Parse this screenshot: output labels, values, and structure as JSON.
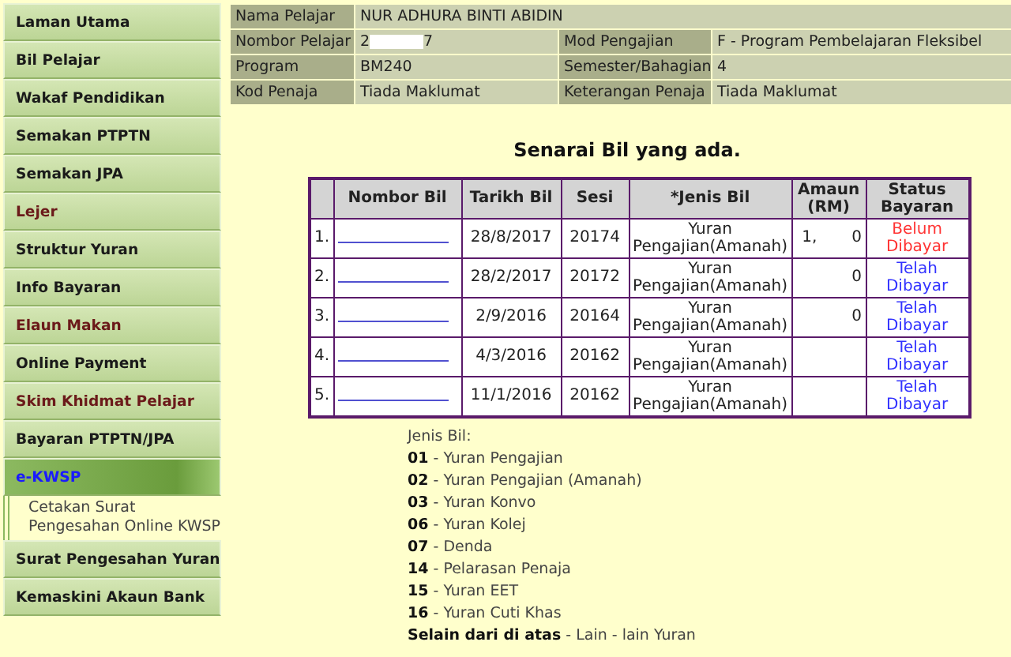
{
  "sidebar": {
    "items": [
      {
        "label": "Laman Utama",
        "color": "#1a1a1a",
        "selected": false
      },
      {
        "label": "Bil Pelajar",
        "color": "#1a1a1a",
        "selected": false
      },
      {
        "label": "Wakaf Pendidikan",
        "color": "#1a1a1a",
        "selected": false
      },
      {
        "label": "Semakan PTPTN",
        "color": "#1a1a1a",
        "selected": false
      },
      {
        "label": "Semakan JPA",
        "color": "#1a1a1a",
        "selected": false
      },
      {
        "label": "Lejer",
        "color": "#6b1a1a",
        "selected": false
      },
      {
        "label": "Struktur Yuran",
        "color": "#1a1a1a",
        "selected": false
      },
      {
        "label": "Info Bayaran",
        "color": "#1a1a1a",
        "selected": false
      },
      {
        "label": "Elaun Makan",
        "color": "#6b1a1a",
        "selected": false
      },
      {
        "label": "Online Payment",
        "color": "#1a1a1a",
        "selected": false
      },
      {
        "label": "Skim Khidmat Pelajar",
        "color": "#6b1a1a",
        "selected": false
      },
      {
        "label": "Bayaran PTPTN/JPA",
        "color": "#1a1a1a",
        "selected": false
      },
      {
        "label": "e-KWSP",
        "color": "#1a1aff",
        "selected": true,
        "children": [
          {
            "label": "Cetakan Surat Pengesahan Online KWSP"
          }
        ]
      },
      {
        "label": "Surat Pengesahan Yuran",
        "color": "#1a1a1a",
        "selected": false
      },
      {
        "label": "Kemaskini Akaun Bank",
        "color": "#1a1a1a",
        "selected": false
      }
    ]
  },
  "student_info": [
    {
      "label": "Nama Pelajar",
      "value": "NUR ADHURA BINTI ABIDIN"
    },
    {
      "label": "Nombor Pelajar",
      "value_start": "2",
      "value_end": "7",
      "label2": "Mod Pengajian",
      "value2": "F - Program Pembelajaran Fleksibel"
    },
    {
      "label": "Program",
      "value": "BM240",
      "label2": "Semester/Bahagian",
      "value2": "4"
    },
    {
      "label": "Kod Penaja",
      "value": "Tiada Maklumat",
      "label2": "Keterangan Penaja",
      "value2": "Tiada Maklumat"
    }
  ],
  "heading": "Senarai Bil yang ada.",
  "table": {
    "columns": [
      "Nombor Bil",
      "Tarikh Bil",
      "Sesi",
      "*Jenis Bil",
      "Amaun (RM)",
      "Status Bayaran"
    ],
    "rows": [
      {
        "index": "1.",
        "date": "28/8/2017",
        "session": "20174",
        "type": "Yuran Pengajian(Amanah)",
        "amount_start": "1,",
        "amount_end": "0",
        "status": "Belum Dibayar",
        "paid": false
      },
      {
        "index": "2.",
        "date": "28/2/2017",
        "session": "20172",
        "type": "Yuran Pengajian(Amanah)",
        "amount_end": "0",
        "status": "Telah Dibayar",
        "paid": true
      },
      {
        "index": "3.",
        "date": "2/9/2016",
        "session": "20164",
        "type": "Yuran Pengajian(Amanah)",
        "amount_end": "0",
        "status": "Telah Dibayar",
        "paid": true
      },
      {
        "index": "4.",
        "date": "4/3/2016",
        "session": "20162",
        "type": "Yuran Pengajian(Amanah)",
        "status": "Telah Dibayar",
        "paid": true
      },
      {
        "index": "5.",
        "date": "11/1/2016",
        "session": "20162",
        "type": "Yuran Pengajian(Amanah)",
        "status": "Telah Dibayar",
        "paid": true
      }
    ]
  },
  "legend": {
    "title": "Jenis Bil:",
    "items": [
      {
        "code": "01",
        "text": "- Yuran Pengajian"
      },
      {
        "code": "02",
        "text": "- Yuran Pengajian (Amanah)"
      },
      {
        "code": "03",
        "text": "- Yuran Konvo"
      },
      {
        "code": "06",
        "text": "- Yuran Kolej"
      },
      {
        "code": "07",
        "text": "- Denda"
      },
      {
        "code": "14",
        "text": "- Pelarasan Penaja"
      },
      {
        "code": "15",
        "text": "- Yuran EET"
      },
      {
        "code": "16",
        "text": "- Yuran Cuti Khas"
      },
      {
        "code": "Selain dari di atas",
        "text": "- Lain - lain Yuran"
      }
    ]
  }
}
